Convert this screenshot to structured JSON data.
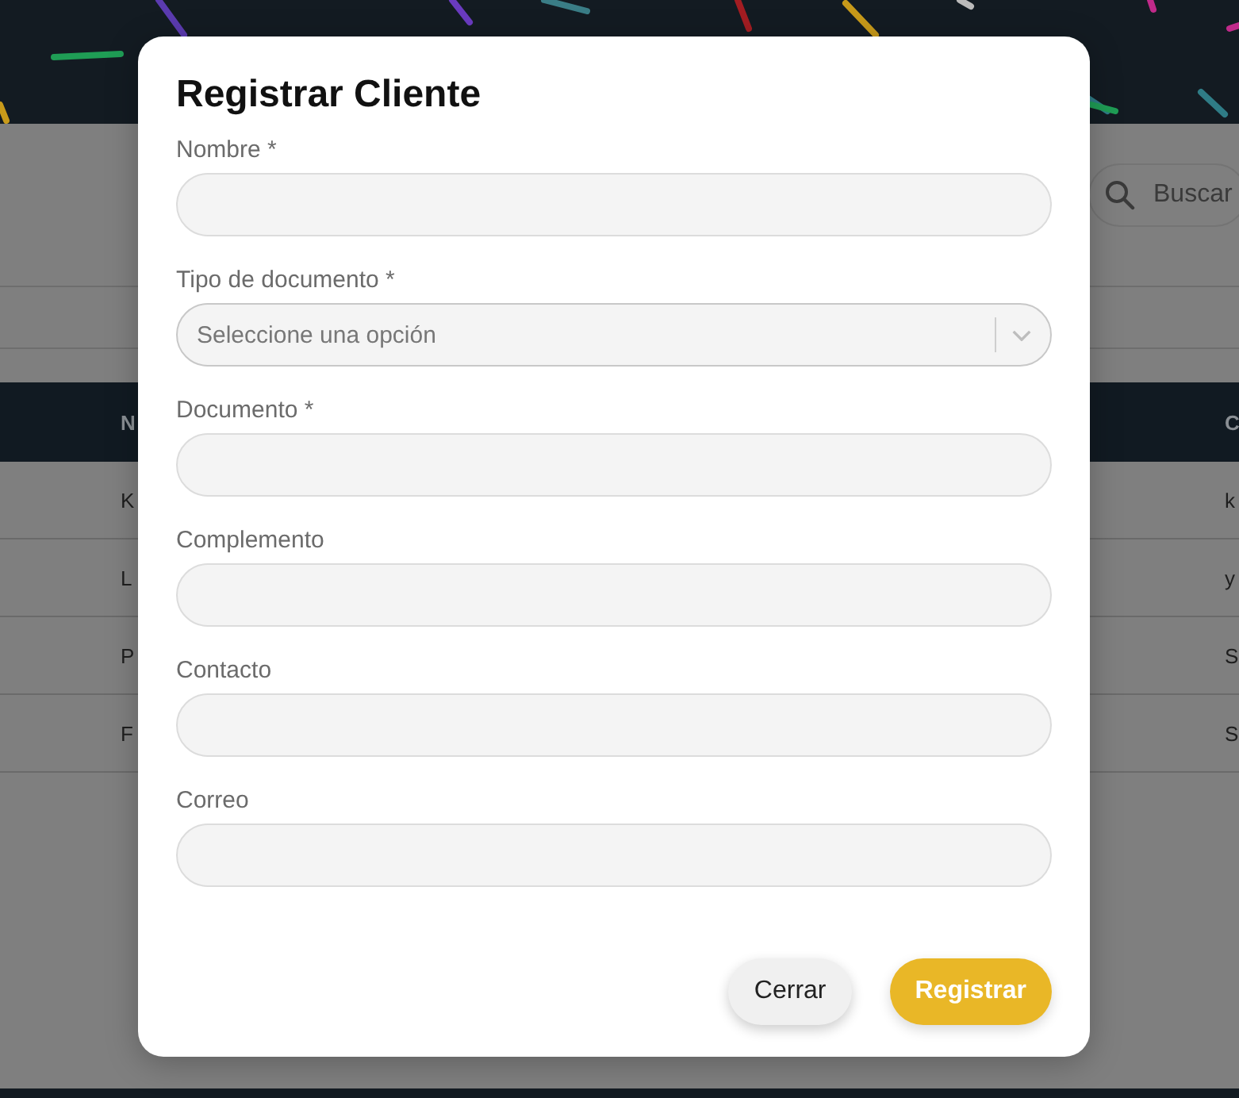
{
  "background": {
    "search": {
      "placeholder": "Buscar"
    },
    "table": {
      "columns": [
        "N",
        "C"
      ],
      "rows": [
        [
          "K",
          "k"
        ],
        [
          "L",
          "y"
        ],
        [
          "P",
          "S"
        ],
        [
          "F",
          "S"
        ]
      ]
    }
  },
  "dialog": {
    "title": "Registrar Cliente",
    "fields": [
      {
        "kind": "input",
        "label": "Nombre *"
      },
      {
        "kind": "select",
        "label": "Tipo de documento *",
        "placeholder": "Seleccione una opción"
      },
      {
        "kind": "input",
        "label": "Documento *"
      },
      {
        "kind": "input",
        "label": "Complemento"
      },
      {
        "kind": "input",
        "label": "Contacto"
      },
      {
        "kind": "input",
        "label": "Correo"
      }
    ],
    "buttons": [
      {
        "kind": "secondary",
        "label": "Cerrar"
      },
      {
        "kind": "primary",
        "label": "Registrar"
      }
    ]
  }
}
